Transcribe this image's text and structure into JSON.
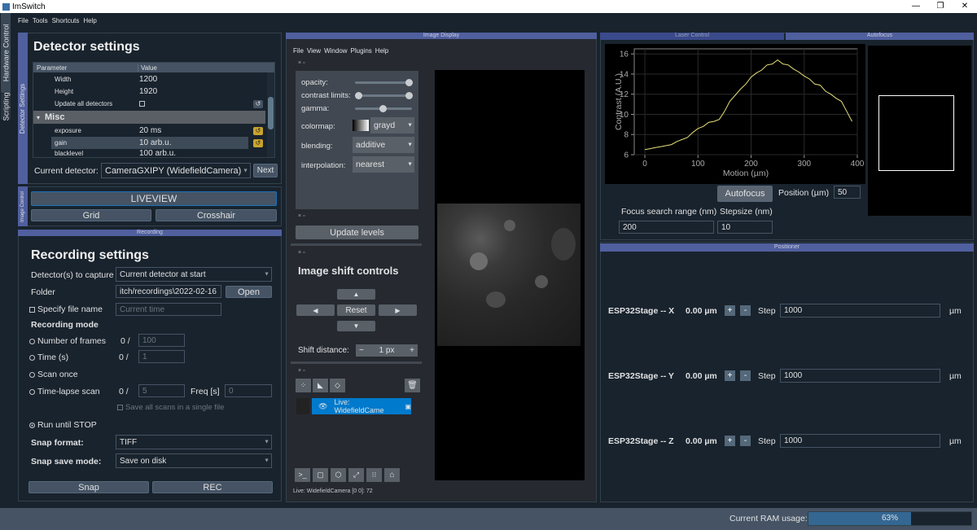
{
  "window": {
    "title": "ImSwitch",
    "minimize": "—",
    "maximize": "❐",
    "close": "✕"
  },
  "menubar": [
    "File",
    "Tools",
    "Shortcuts",
    "Help"
  ],
  "side_tabs": {
    "hardware": "Hardware Control",
    "scripting": "Scripting"
  },
  "detector": {
    "tab_label": "Detector Settings",
    "title": "Detector settings",
    "col_param": "Parameter",
    "col_value": "Value",
    "rows": [
      {
        "param": "Width",
        "value": "1200"
      },
      {
        "param": "Height",
        "value": "1920"
      },
      {
        "param": "Update all detectors",
        "value": ""
      },
      {
        "param": "Misc",
        "value": ""
      },
      {
        "param": "exposure",
        "value": "20 ms"
      },
      {
        "param": "gain",
        "value": "10 arb.u."
      },
      {
        "param": "blacklevel",
        "value": "100 arb.u."
      }
    ],
    "current_label": "Current detector:",
    "current_value": "CameraGXIPY (WidefieldCamera)",
    "next": "Next"
  },
  "image_control": {
    "tab_label": "Image Control",
    "liveview": "LIVEVIEW",
    "grid": "Grid",
    "crosshair": "Crosshair"
  },
  "recording": {
    "header": "Recording",
    "title": "Recording settings",
    "capture_label": "Detector(s) to capture",
    "capture_value": "Current detector at start",
    "folder_label": "Folder",
    "folder_value": "itch/recordings\\2022-02-16",
    "open": "Open",
    "specify_label": "Specify file name",
    "specify_placeholder": "Current time",
    "mode_label": "Recording mode",
    "frames_label": "Number of frames",
    "frames_count": "0 /",
    "frames_placeholder": "100",
    "time_label": "Time (s)",
    "time_count": "0 /",
    "time_placeholder": "1",
    "scan_once": "Scan once",
    "timelapse_label": "Time-lapse scan",
    "timelapse_count": "0 /",
    "timelapse_placeholder": "5",
    "freq_label": "Freq [s]",
    "freq_placeholder": "0",
    "save_all": "Save all scans in a single file",
    "run_until": "Run until STOP",
    "snap_format_label": "Snap format:",
    "snap_format_value": "TIFF",
    "snap_mode_label": "Snap save mode:",
    "snap_mode_value": "Save on disk",
    "snap": "Snap",
    "rec": "REC"
  },
  "image_display": {
    "header": "Image Display",
    "menu": [
      "File",
      "View",
      "Window",
      "Plugins",
      "Help"
    ],
    "controls": {
      "opacity": "opacity:",
      "contrast": "contrast limits:",
      "gamma": "gamma:",
      "colormap": "colormap:",
      "colormap_value": "grayd",
      "blending": "blending:",
      "blending_value": "additive",
      "interpolation": "interpolation:",
      "interpolation_value": "nearest"
    },
    "update_levels": "Update levels",
    "shift_title": "Image shift controls",
    "reset": "Reset",
    "shift_distance_label": "Shift distance:",
    "shift_distance_value": "1 px",
    "minus": "−",
    "plus": "+",
    "layer_name": "Live: WidefieldCame",
    "status": "Live: WidefieldCamera [0 0]: 72"
  },
  "laser": {
    "header": "Laser Control"
  },
  "autofocus": {
    "header": "Autofocus",
    "button": "Autofocus",
    "position_label": "Position (µm)",
    "position_value": "50",
    "range_label": "Focus search range (nm)",
    "range_value": "200",
    "stepsize_label": "Stepsize (nm)",
    "stepsize_value": "10"
  },
  "chart_data": {
    "type": "line",
    "xlabel": "Motion (µm)",
    "ylabel": "Contrast (A.U.)",
    "xlim": [
      -20,
      400
    ],
    "ylim": [
      6,
      16.5
    ],
    "xticks": [
      "0",
      "100",
      "200",
      "300",
      "400"
    ],
    "yticks": [
      "6",
      "8",
      "10",
      "12",
      "14",
      "16"
    ],
    "color": "#e8e07a",
    "x": [
      0,
      10,
      20,
      30,
      40,
      50,
      60,
      70,
      80,
      90,
      100,
      110,
      120,
      130,
      140,
      150,
      160,
      170,
      180,
      190,
      200,
      210,
      220,
      230,
      240,
      250,
      260,
      270,
      280,
      290,
      300,
      310,
      320,
      330,
      340,
      350,
      360,
      370,
      380,
      390
    ],
    "y": [
      6.5,
      6.6,
      6.7,
      6.8,
      6.9,
      7.0,
      7.3,
      7.5,
      7.7,
      8.2,
      8.6,
      8.8,
      9.2,
      9.3,
      9.5,
      10.3,
      11.3,
      11.9,
      12.5,
      13.0,
      13.7,
      14.1,
      14.4,
      14.9,
      15.0,
      15.4,
      15.0,
      14.9,
      14.5,
      14.2,
      13.8,
      13.5,
      13.0,
      12.9,
      12.3,
      12.0,
      11.6,
      11.3,
      10.3,
      9.3
    ]
  },
  "positioner": {
    "header": "Positioner",
    "axes": [
      {
        "name": "ESP32Stage -- X",
        "pos": "0.00 µm",
        "step": "1000"
      },
      {
        "name": "ESP32Stage -- Y",
        "pos": "0.00 µm",
        "step": "1000"
      },
      {
        "name": "ESP32Stage -- Z",
        "pos": "0.00 µm",
        "step": "1000"
      }
    ],
    "step_label": "Step",
    "unit": "µm",
    "plus": "+",
    "minus": "-"
  },
  "status": {
    "ram_label": "Current RAM usage:",
    "ram_value": "63%",
    "ram_fraction": 0.63
  }
}
